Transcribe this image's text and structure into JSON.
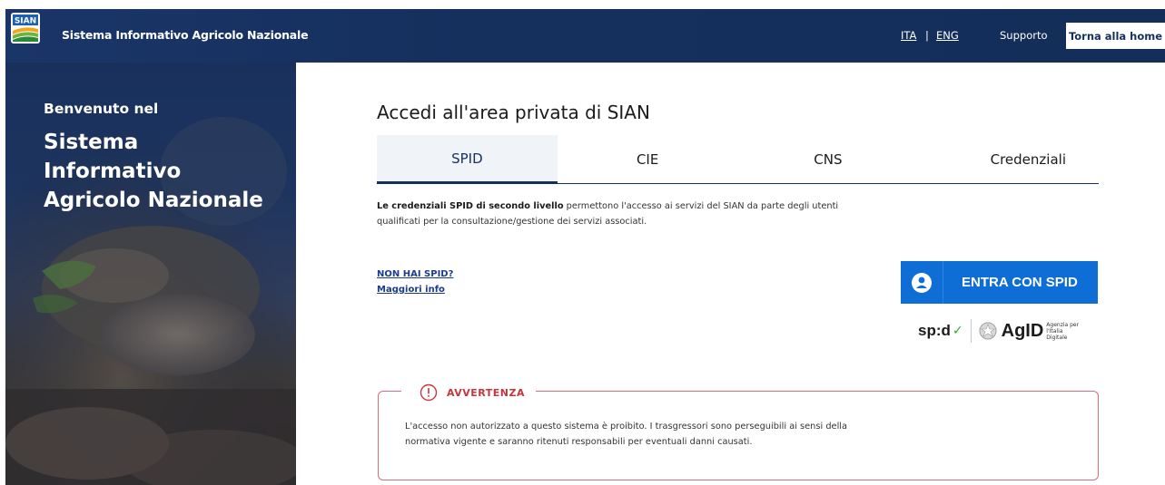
{
  "header": {
    "logo_text": "SIAN",
    "title": "Sistema Informativo Agricolo Nazionale",
    "lang_ita": "ITA",
    "lang_separator": "|",
    "lang_eng": "ENG",
    "support": "Supporto",
    "home_button": "Torna alla home"
  },
  "hero": {
    "welcome": "Benvenuto nel",
    "title": "Sistema Informativo Agricolo Nazionale"
  },
  "main": {
    "page_title": "Accedi all'area privata di SIAN",
    "tabs": [
      {
        "label": "SPID",
        "active": true
      },
      {
        "label": "CIE",
        "active": false
      },
      {
        "label": "CNS",
        "active": false
      },
      {
        "label": "Credenziali",
        "active": false
      }
    ],
    "description_bold": "Le credenziali SPID di secondo livello",
    "description_rest": " permettono l'accesso ai servizi del SIAN da parte degli utenti qualificati per la consultazione/gestione dei servizi associati.",
    "link_no_spid": "NON HAI SPID?",
    "link_more_info": "Maggiori info",
    "spid_button": "ENTRA CON SPID",
    "spid_logo": "sp:d",
    "agid_logo": "AgID",
    "agid_sub": "Agenzia per l'Italia Digitale"
  },
  "warning": {
    "title": "AVVERTENZA",
    "text": "L'accesso non autorizzato a questo sistema è proibito. I trasgressori sono perseguibili ai sensi della normativa vigente e saranno ritenuti responsabili per eventuali danni causati."
  },
  "colors": {
    "header_bg": "#16305e",
    "spid_blue": "#0f6dd6",
    "warning_red": "#c8363d",
    "warning_border": "#d76b80"
  }
}
